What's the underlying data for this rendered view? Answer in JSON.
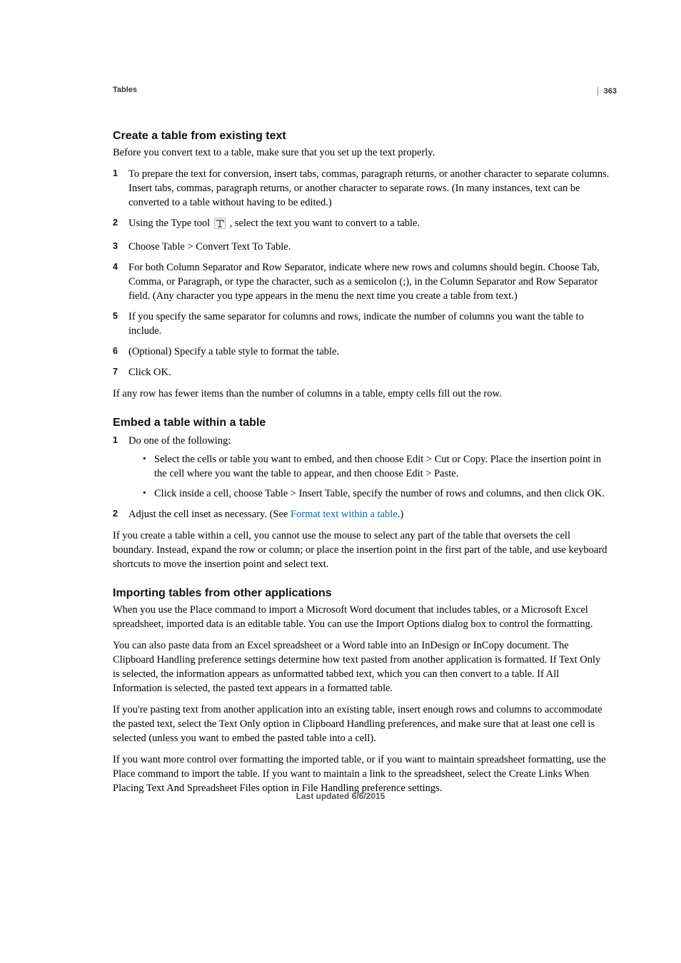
{
  "header": {
    "section": "Tables",
    "page_number": "363"
  },
  "sections": {
    "s1": {
      "title": "Create a table from existing text",
      "intro": "Before you convert text to a table, make sure that you set up the text properly.",
      "steps": [
        "To prepare the text for conversion, insert tabs, commas, paragraph returns, or another character to separate columns. Insert tabs, commas, paragraph returns, or another character to separate rows. (In many instances, text can be converted to a table without having to be edited.)",
        {
          "before": "Using the Type tool ",
          "after": " , select the text you want to convert to a table."
        },
        "Choose Table > Convert Text To Table.",
        "For both Column Separator and Row Separator, indicate where new rows and columns should begin. Choose Tab, Comma, or Paragraph, or type the character, such as a semicolon (;), in the Column Separator and Row Separator field. (Any character you type appears in the menu the next time you create a table from text.)",
        "If you specify the same separator for columns and rows, indicate the number of columns you want the table to include.",
        "(Optional) Specify a table style to format the table.",
        "Click OK."
      ],
      "closing": "If any row has fewer items than the number of columns in a table, empty cells fill out the row."
    },
    "s2": {
      "title": "Embed a table within a table",
      "steps": {
        "1": "Do one of the following:",
        "sub": [
          "Select the cells or table you want to embed, and then choose Edit > Cut or Copy. Place the insertion point in the cell where you want the table to appear, and then choose Edit > Paste.",
          "Click inside a cell, choose Table > Insert Table, specify the number of rows and columns, and then click OK."
        ],
        "2_before": "Adjust the cell inset as necessary. (See ",
        "2_link": "Format text within a table",
        "2_after": ".)"
      },
      "closing": "If you create a table within a cell, you cannot use the mouse to select any part of the table that oversets the cell boundary. Instead, expand the row or column; or place the insertion point in the first part of the table, and use keyboard shortcuts to move the insertion point and select text."
    },
    "s3": {
      "title": "Importing tables from other applications",
      "paras": [
        "When you use the Place command to import a Microsoft Word document that includes tables, or a Microsoft Excel spreadsheet, imported data is an editable table. You can use the Import Options dialog box to control the formatting.",
        "You can also paste data from an Excel spreadsheet or a Word table into an InDesign or InCopy document. The Clipboard Handling preference settings determine how text pasted from another application is formatted. If Text Only is selected, the information appears as unformatted tabbed text, which you can then convert to a table. If All Information is selected, the pasted text appears in a formatted table.",
        "If you're pasting text from another application into an existing table, insert enough rows and columns to accommodate the pasted text, select the Text Only option in Clipboard Handling preferences, and make sure that at least one cell is selected (unless you want to embed the pasted table into a cell).",
        "If you want more control over formatting the imported table, or if you want to maintain spreadsheet formatting, use the Place command to import the table. If you want to maintain a link to the spreadsheet, select the Create Links When Placing Text And Spreadsheet Files option in File Handling preference settings."
      ]
    }
  },
  "footer": "Last updated 6/6/2015"
}
